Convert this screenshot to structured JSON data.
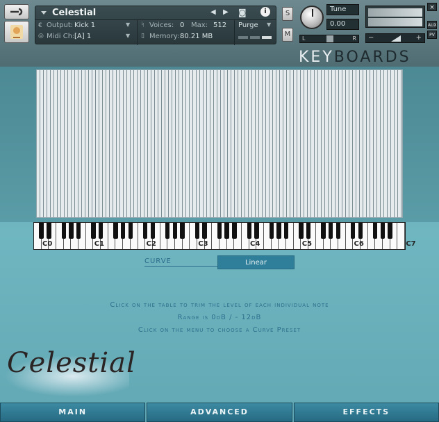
{
  "header": {
    "instrument_name": "Celestial",
    "output_label": "Output:",
    "output_value": "Kick 1",
    "voices_label": "Voices:",
    "voices_value": "0",
    "max_label": "Max:",
    "max_value": "512",
    "purge_label": "Purge",
    "midi_label": "Midi Ch:",
    "midi_value": "[A]  1",
    "memory_label": "Memory:",
    "memory_value": "80.21 MB",
    "solo_label": "S",
    "mute_label": "M",
    "tune_label": "Tune",
    "tune_value": "0.00",
    "pan_left": "L",
    "pan_right": "R",
    "aux_label": "AUX",
    "pv_label": "PV",
    "close_label": "×",
    "brand_part1": "KEY",
    "brand_part2": "BOARDS"
  },
  "keyboard": {
    "octave_labels": [
      "C0",
      "C1",
      "C2",
      "C3",
      "C4",
      "C5",
      "C6",
      "C7"
    ]
  },
  "curve": {
    "label": "CURVE",
    "selected": "Linear"
  },
  "instructions": {
    "line1": "Click on the table to trim the level of each individual note",
    "line2": "Range is 0dB / - 12dB",
    "line3": "Click on the menu to choose a Curve Preset"
  },
  "logo_text": "Celestial",
  "tabs": [
    {
      "label": "MAIN"
    },
    {
      "label": "ADVANCED"
    },
    {
      "label": "EFFECTS"
    }
  ],
  "colors": {
    "accent": "#2f7f9a",
    "text_blue": "#2d6f8d"
  }
}
